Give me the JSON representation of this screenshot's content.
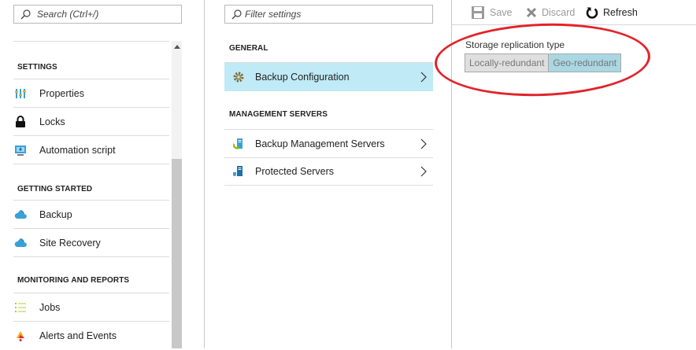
{
  "left_panel": {
    "search_placeholder": "Search (Ctrl+/)",
    "sections": [
      {
        "title": "SETTINGS",
        "items": [
          {
            "label": "Properties",
            "icon": "properties-icon"
          },
          {
            "label": "Locks",
            "icon": "lock-icon"
          },
          {
            "label": "Automation script",
            "icon": "automation-script-icon"
          }
        ]
      },
      {
        "title": "GETTING STARTED",
        "items": [
          {
            "label": "Backup",
            "icon": "cloud-backup-icon"
          },
          {
            "label": "Site Recovery",
            "icon": "cloud-recovery-icon"
          }
        ]
      },
      {
        "title": "MONITORING AND REPORTS",
        "items": [
          {
            "label": "Jobs",
            "icon": "jobs-list-icon"
          },
          {
            "label": "Alerts and Events",
            "icon": "alert-bell-icon"
          }
        ]
      }
    ]
  },
  "middle_panel": {
    "search_placeholder": "Filter settings",
    "sections": [
      {
        "title": "GENERAL",
        "items": [
          {
            "label": "Backup Configuration",
            "icon": "gear-icon",
            "active": true
          }
        ]
      },
      {
        "title": "MANAGEMENT SERVERS",
        "items": [
          {
            "label": "Backup Management Servers",
            "icon": "backup-server-icon"
          },
          {
            "label": "Protected Servers",
            "icon": "protected-server-icon"
          }
        ]
      }
    ]
  },
  "right_panel": {
    "toolbar": {
      "save_label": "Save",
      "discard_label": "Discard",
      "refresh_label": "Refresh"
    },
    "field_label": "Storage replication type",
    "options": [
      "Locally-redundant",
      "Geo-redundant"
    ],
    "selected_option": "Geo-redundant"
  },
  "colors": {
    "active_item_bg": "#bfeaf6",
    "selected_toggle_bg": "#a9d7e2",
    "annotation_red": "#e2232a"
  }
}
